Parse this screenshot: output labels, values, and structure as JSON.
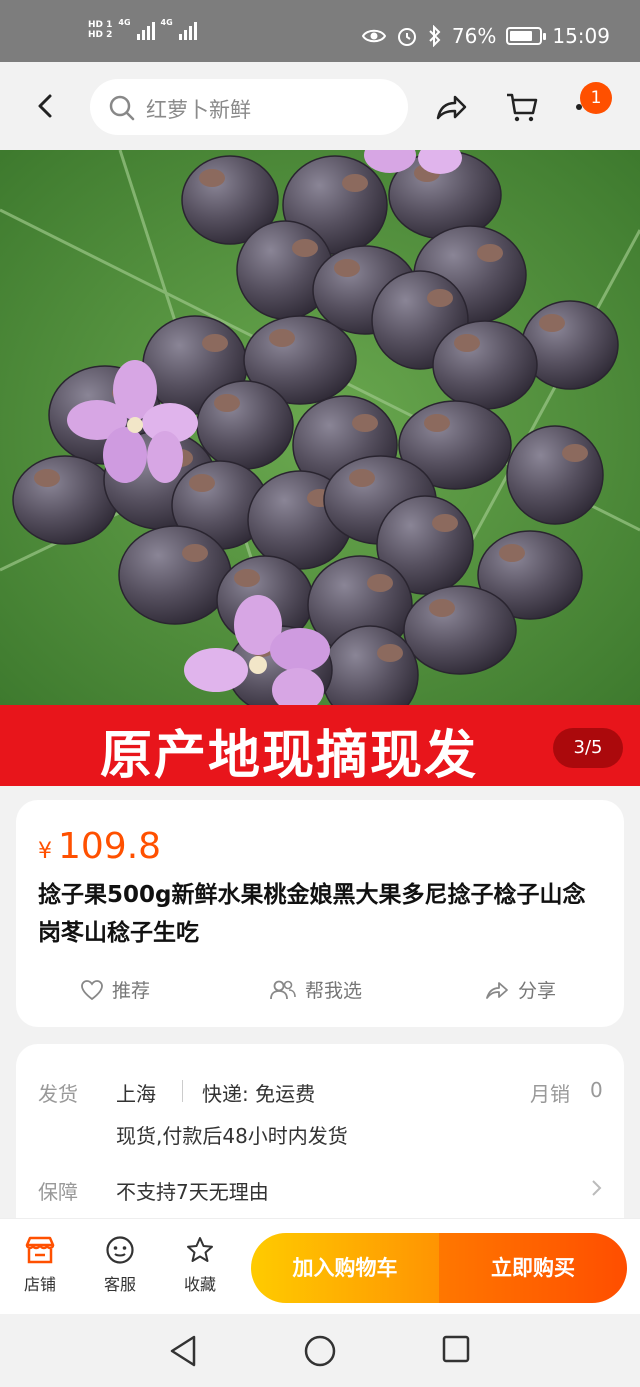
{
  "status_bar": {
    "sim1": "HD 1",
    "sim2": "HD 2",
    "net1": "4G",
    "net2": "4G",
    "battery_percent_text": "76%",
    "battery_level": 0.76,
    "time": "15:09"
  },
  "header": {
    "search_placeholder": "红萝卜新鲜",
    "cart_badge": "1"
  },
  "gallery": {
    "banner_text": "原产地现摘现发",
    "counter": "3/5"
  },
  "product": {
    "currency": "¥",
    "price": "109.8",
    "title": "捻子果500g新鲜水果桃金娘黑大果多尼捻子棯子山念岗苳山稔子生吃",
    "actions": [
      {
        "label": "推荐"
      },
      {
        "label": "帮我选"
      },
      {
        "label": "分享"
      }
    ]
  },
  "shipping": {
    "ship_label": "发货",
    "origin": "上海",
    "express": "快递: 免运费",
    "monthly_sales_label": "月销",
    "monthly_sales": "0",
    "delivery_note": "现货,付款后48小时内发货",
    "guarantee_label": "保障",
    "guarantee_text": "不支持7天无理由"
  },
  "bottom_bar": {
    "tabs": [
      {
        "label": "店铺"
      },
      {
        "label": "客服"
      },
      {
        "label": "收藏"
      }
    ],
    "add_to_cart": "加入购物车",
    "buy_now": "立即购买"
  },
  "colors": {
    "accent": "#ff5000",
    "banner": "#e8151b",
    "cart_button": "#ffb400",
    "buy_button": "#ff5a00"
  }
}
